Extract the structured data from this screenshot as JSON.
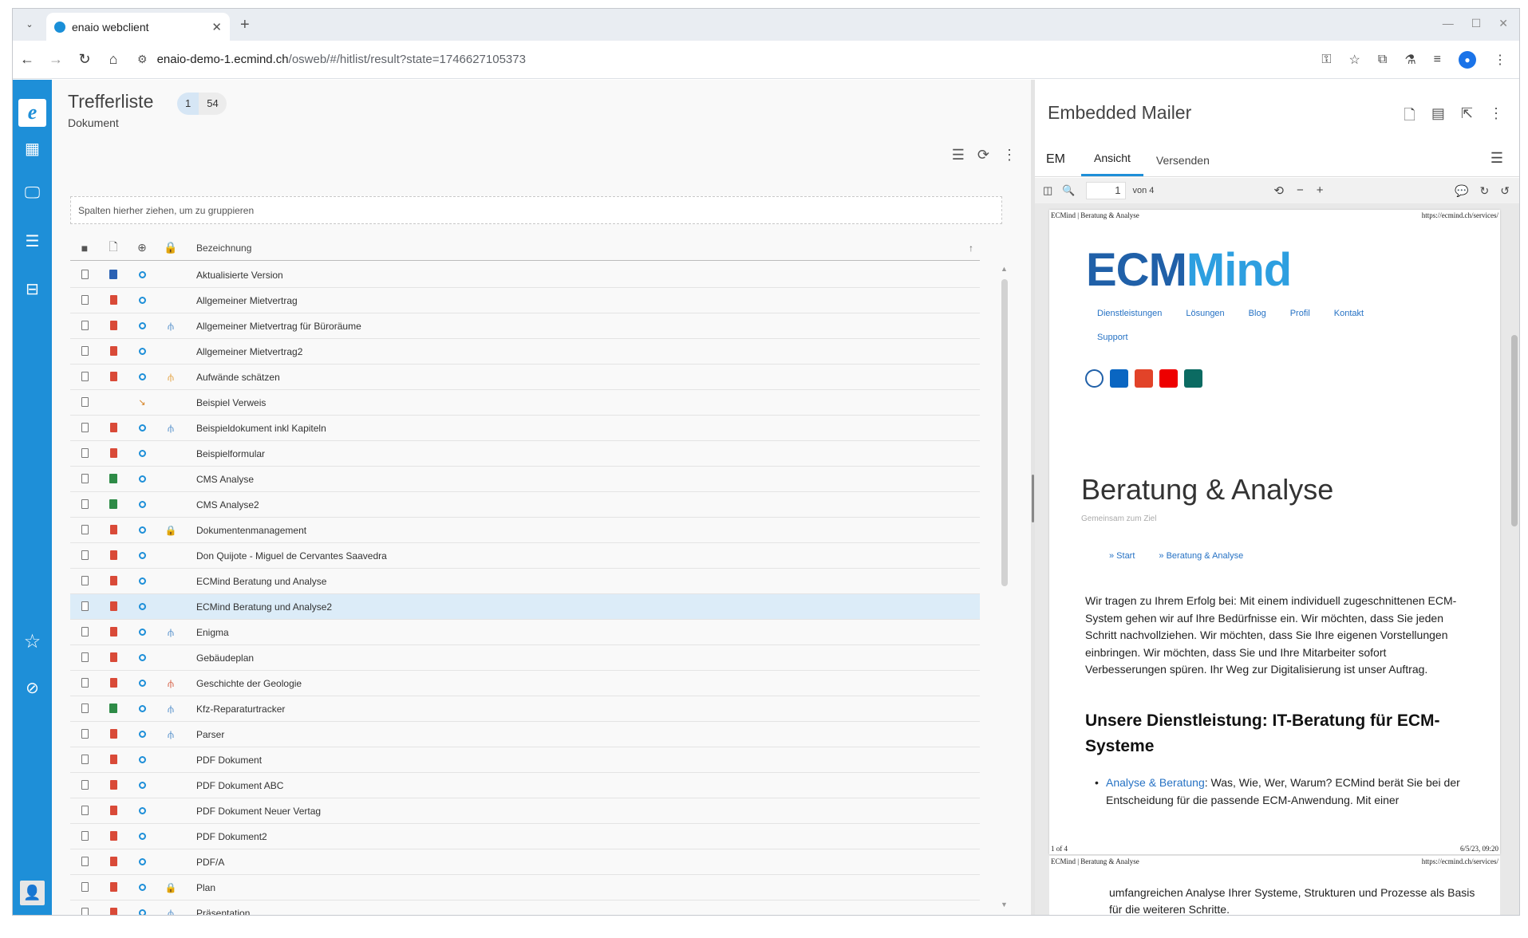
{
  "browser": {
    "tab_title": "enaio webclient",
    "url_domain": "enaio-demo-1.ecmind.ch",
    "url_path": "/osweb/#/hitlist/result?state=1746627105373"
  },
  "hitlist": {
    "title": "Trefferliste",
    "subtitle": "Dokument",
    "badge_selected": "1",
    "badge_total": "54",
    "group_hint": "Spalten hierher ziehen, um zu gruppieren",
    "column_name": "Bezeichnung",
    "rows": [
      {
        "type": "word",
        "circle": true,
        "extra": "",
        "name": "Aktualisierte Version"
      },
      {
        "type": "pdf",
        "circle": true,
        "extra": "",
        "name": "Allgemeiner Mietvertrag"
      },
      {
        "type": "pdf",
        "circle": true,
        "extra": "tree",
        "name": "Allgemeiner Mietvertrag für Büroräume"
      },
      {
        "type": "pdf",
        "circle": true,
        "extra": "",
        "name": "Allgemeiner Mietvertrag2"
      },
      {
        "type": "pdf",
        "circle": true,
        "extra": "tree-o",
        "name": "Aufwände schätzen"
      },
      {
        "type": "none",
        "circle": false,
        "extra": "ref",
        "name": "Beispiel Verweis"
      },
      {
        "type": "pdf",
        "circle": true,
        "extra": "tree",
        "name": "Beispieldokument inkl Kapiteln"
      },
      {
        "type": "pdf",
        "circle": true,
        "extra": "",
        "name": "Beispielformular"
      },
      {
        "type": "xls",
        "circle": true,
        "extra": "",
        "name": "CMS Analyse"
      },
      {
        "type": "xls",
        "circle": true,
        "extra": "",
        "name": "CMS Analyse2"
      },
      {
        "type": "pdf",
        "circle": true,
        "extra": "lock",
        "name": "Dokumentenmanagement"
      },
      {
        "type": "pdf",
        "circle": true,
        "extra": "",
        "name": "Don Quijote - Miguel de Cervantes Saavedra"
      },
      {
        "type": "pdf",
        "circle": true,
        "extra": "",
        "name": "ECMind Beratung und Analyse"
      },
      {
        "type": "pdf",
        "circle": true,
        "extra": "",
        "name": "ECMind Beratung und Analyse2",
        "selected": true
      },
      {
        "type": "pdf",
        "circle": true,
        "extra": "tree",
        "name": "Enigma"
      },
      {
        "type": "pdf",
        "circle": true,
        "extra": "",
        "name": "Gebäudeplan"
      },
      {
        "type": "pdf",
        "circle": true,
        "extra": "tree-r",
        "name": "Geschichte der Geologie"
      },
      {
        "type": "xls",
        "circle": true,
        "extra": "tree",
        "name": "Kfz-Reparaturtracker"
      },
      {
        "type": "pdf",
        "circle": true,
        "extra": "tree",
        "name": "Parser"
      },
      {
        "type": "pdf",
        "circle": true,
        "extra": "",
        "name": "PDF Dokument"
      },
      {
        "type": "pdf",
        "circle": true,
        "extra": "",
        "name": "PDF Dokument ABC"
      },
      {
        "type": "pdf",
        "circle": true,
        "extra": "",
        "name": "PDF Dokument Neuer Vertag"
      },
      {
        "type": "pdf",
        "circle": true,
        "extra": "",
        "name": "PDF Dokument2"
      },
      {
        "type": "pdf",
        "circle": true,
        "extra": "",
        "name": "PDF/A"
      },
      {
        "type": "pdf",
        "circle": true,
        "extra": "lock",
        "name": "Plan"
      },
      {
        "type": "pdf",
        "circle": true,
        "extra": "tree",
        "name": "Präsentation"
      }
    ]
  },
  "preview": {
    "title": "Embedded Mailer",
    "tab_em": "EM",
    "tab_view": "Ansicht",
    "tab_send": "Versenden",
    "page_current": "1",
    "page_of": "von 4",
    "page1": {
      "header_left": "ECMind | Beratung & Analyse",
      "header_right": "https://ecmind.ch/services/",
      "logo_a": "ECM",
      "logo_b": "ind",
      "nav": [
        "Dienstleistungen",
        "Lösungen",
        "Blog",
        "Profil",
        "Kontakt"
      ],
      "nav2": "Support",
      "heading": "Beratung & Analyse",
      "subheading": "Gemeinsam zum Ziel",
      "crumb1": "» Start",
      "crumb2": "» Beratung & Analyse",
      "paragraph": "Wir tragen zu Ihrem Erfolg bei: Mit einem individuell zugeschnittenen ECM-System gehen wir auf Ihre Bedürfnisse ein. Wir möchten, dass Sie jeden Schritt nachvollziehen. Wir möchten, dass Sie Ihre eigenen Vorstellungen einbringen. Wir möchten, dass Sie und Ihre Mitarbeiter sofort Verbesserungen spüren. Ihr Weg zur Digitalisierung ist unser Auftrag.",
      "h3": "Unsere Dienstleistung: IT-Beratung für ECM-Systeme",
      "bullet_link": "Analyse & Beratung",
      "bullet_text": ": Was, Wie, Wer, Warum? ECMind berät Sie bei der Entscheidung für die passende ECM-Anwendung. Mit einer",
      "footer_left": "1 of 4",
      "footer_right": "6/5/23, 09:20"
    },
    "page2": {
      "header_left": "ECMind | Beratung & Analyse",
      "header_right": "https://ecmind.ch/services/",
      "text": "umfangreichen Analyse Ihrer Systeme, Strukturen und Prozesse als Basis für die weiteren Schritte."
    }
  },
  "colors": {
    "rail": "#1e8fd8",
    "selected_row": "#dcecf8",
    "link": "#2672c4"
  }
}
